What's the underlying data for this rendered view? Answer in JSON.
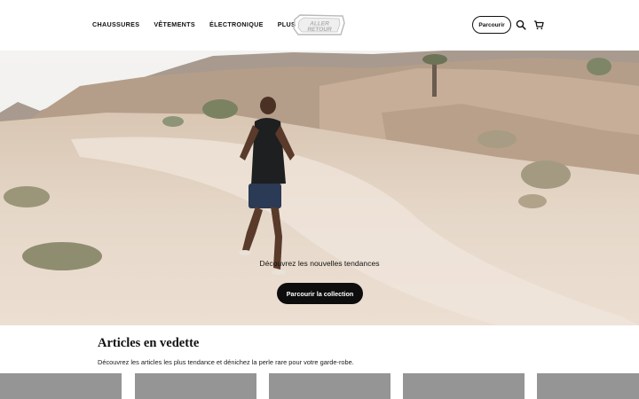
{
  "header": {
    "nav": [
      "CHAUSSURES",
      "VÊTEMENTS",
      "ÉLECTRONIQUE",
      "PLUS"
    ],
    "logo_text": "ALLER RETOUR",
    "browse_button": "Parcourir",
    "icons": [
      "search-icon",
      "cart-icon"
    ]
  },
  "hero": {
    "subtitle": "Découvrez les nouvelles tendances",
    "cta": "Parcourir la collection"
  },
  "featured": {
    "title": "Articles en vedette",
    "description": "Découvrez les articles les plus tendance et dénichez la perle rare pour votre garde-robe.",
    "card_count": 5
  },
  "colors": {
    "cta_bg": "#0d0d0d",
    "card_placeholder": "#959595",
    "hero_ground": "#e9ddd0"
  }
}
